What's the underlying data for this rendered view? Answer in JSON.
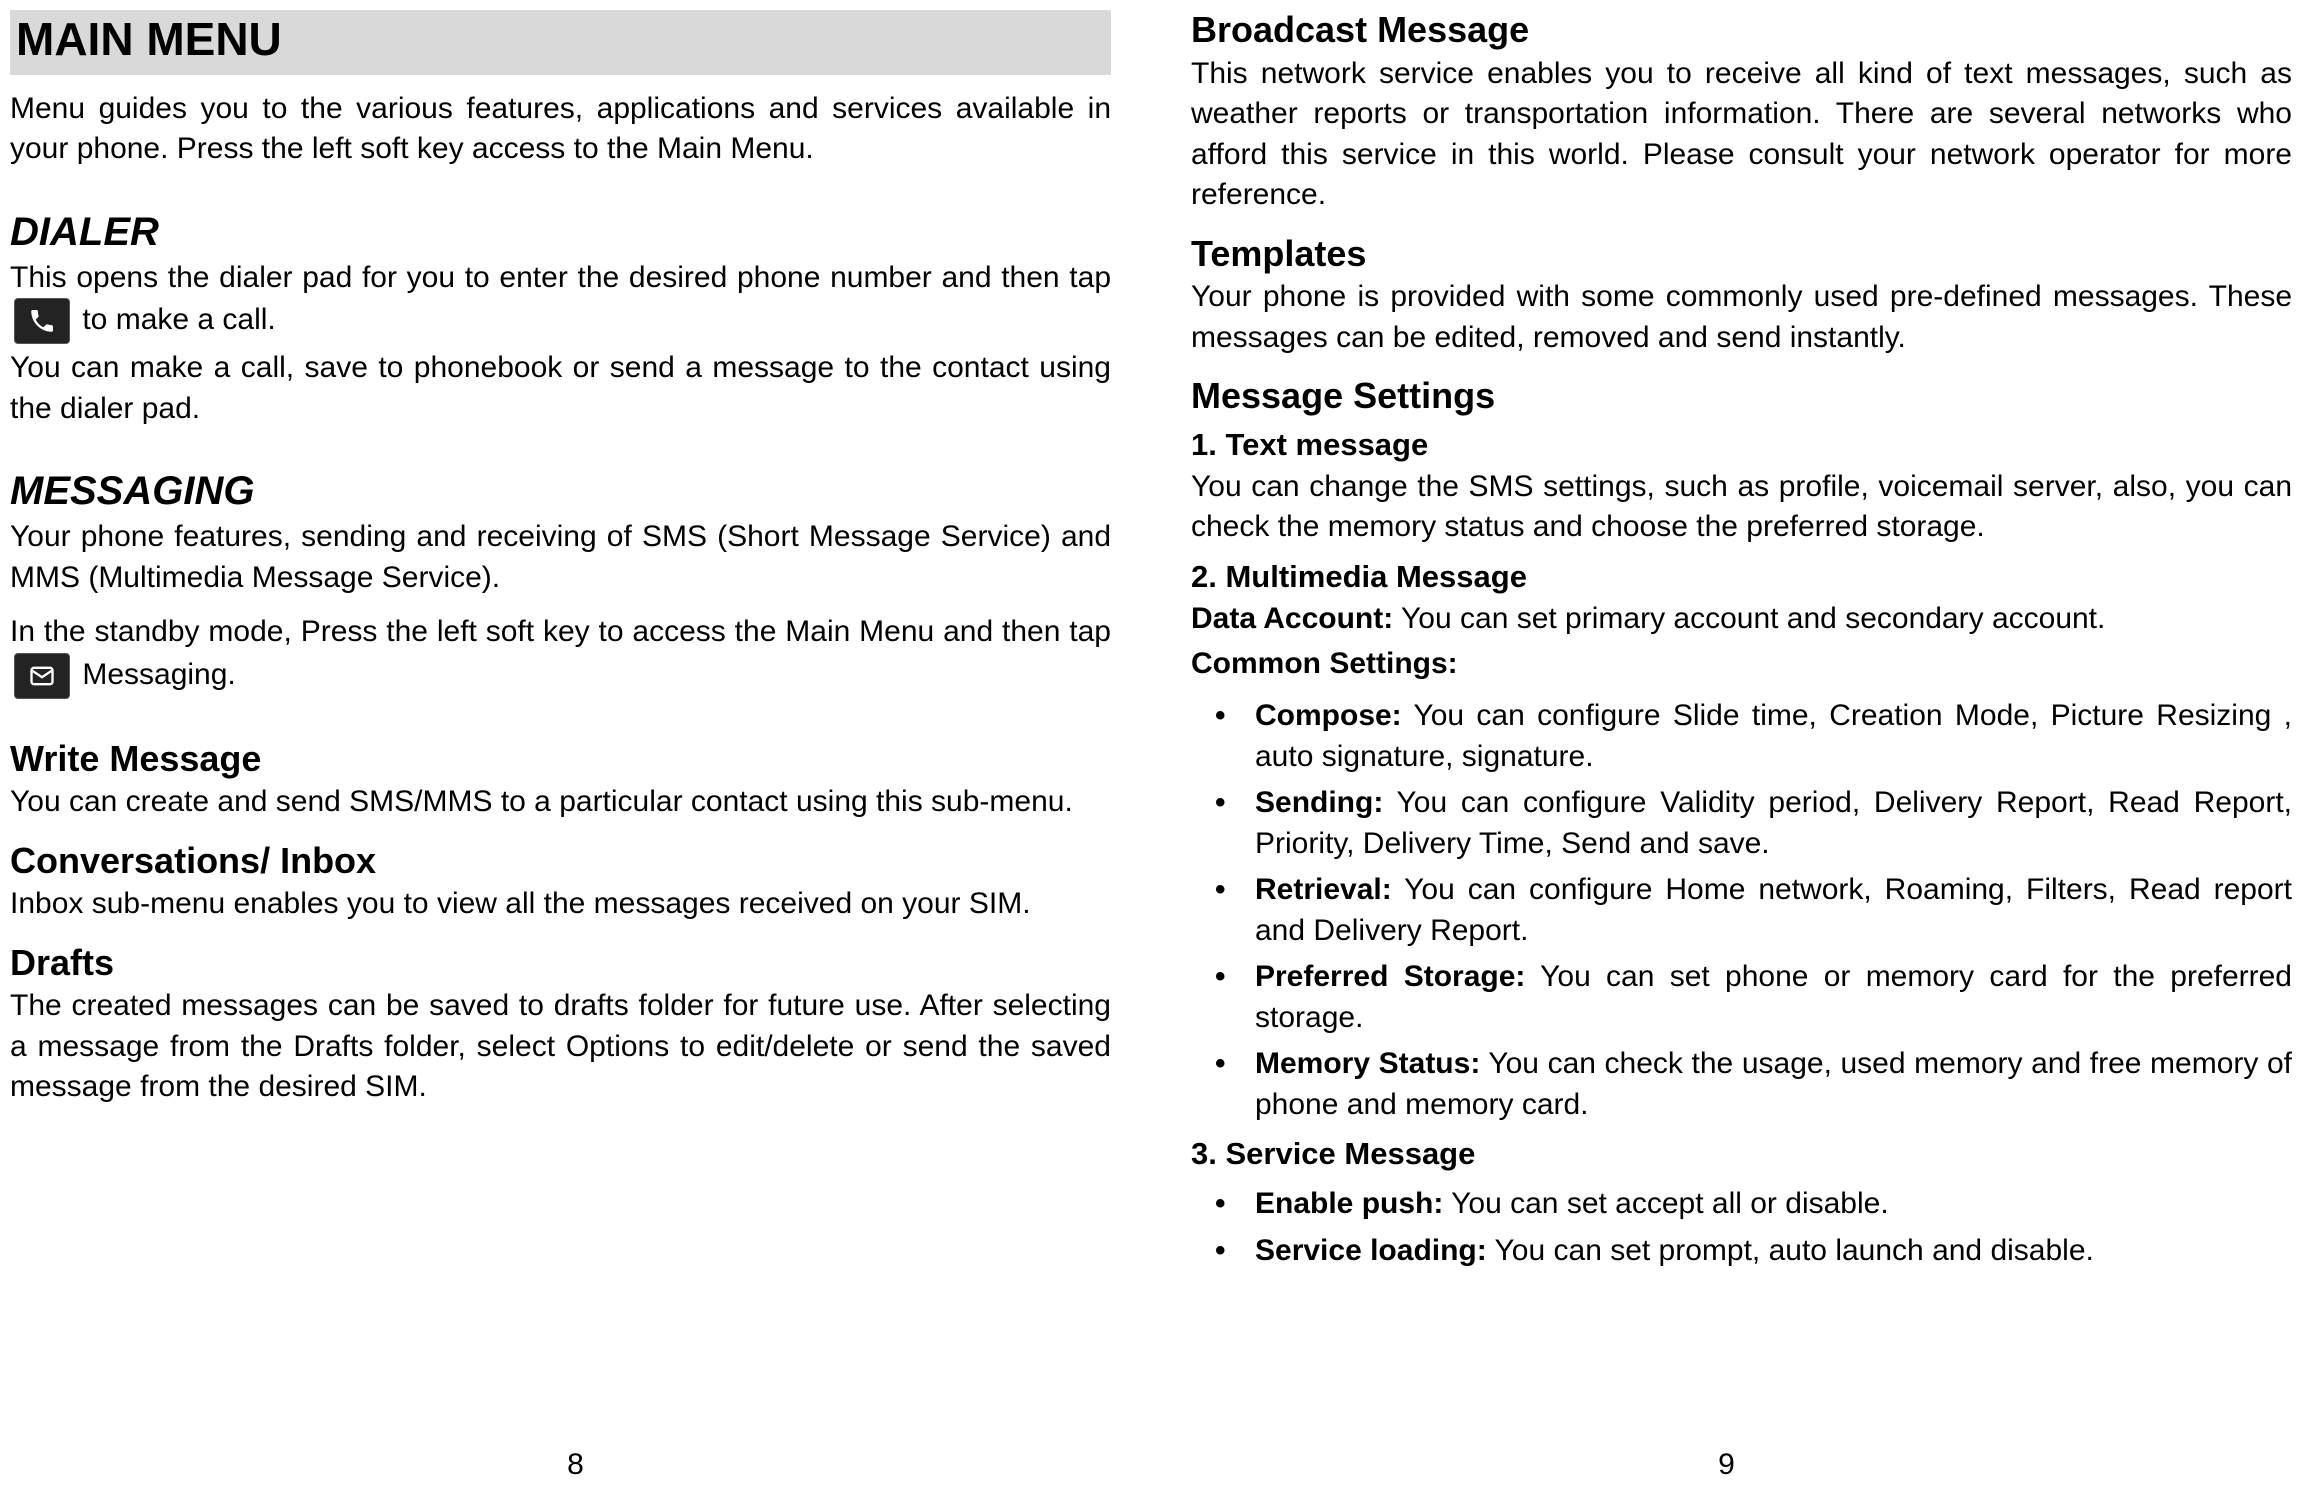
{
  "left": {
    "page_number": "8",
    "title": "MAIN MENU",
    "intro": "Menu guides you to the various features, applications and services available in your phone. Press the left soft key access to the Main Menu.",
    "dialer": {
      "heading": "DIALER",
      "p1a": "This opens the dialer pad for you to enter the desired phone number and then tap ",
      "p1b": " to make a call.",
      "p2": "You can make a call, save to phonebook or send a message to the contact using the dialer pad."
    },
    "messaging": {
      "heading": "MESSAGING",
      "p1": "Your phone features, sending and receiving of SMS (Short Message Service) and MMS (Multimedia Message Service).",
      "p2a": "In the standby mode, Press the left soft key to access the Main Menu and then tap ",
      "p2b": " Messaging."
    },
    "write": {
      "heading": "Write Message",
      "p1": "You can create and send SMS/MMS to a particular contact using this sub-menu."
    },
    "inbox": {
      "heading": "Conversations/ Inbox",
      "p1": "Inbox sub-menu enables you to view all the messages received on your SIM."
    },
    "drafts": {
      "heading": "Drafts",
      "p1": "The created messages can be saved to drafts folder for future use. After selecting a message from the Drafts folder, select Options to edit/delete or send the saved message from the desired SIM."
    }
  },
  "right": {
    "page_number": "9",
    "broadcast": {
      "heading": "Broadcast Message",
      "p1": "This network service enables you to receive all kind of text messages, such as weather reports or transportation information. There are several networks who afford this service in this world. Please consult your network operator for more reference."
    },
    "templates": {
      "heading": "Templates",
      "p1": "Your phone is provided with some commonly used pre-defined messages. These messages can be edited, removed and send instantly."
    },
    "settings": {
      "heading": "Message Settings",
      "text_msg": {
        "heading": "1. Text message",
        "p1": "You can change the SMS settings, such as profile, voicemail server, also, you can check the memory status and choose the preferred storage."
      },
      "mms": {
        "heading": "2. Multimedia Message",
        "data_account_label": "Data Account:",
        "data_account_text": " You can set primary account and secondary account.",
        "common_settings_label": "Common Settings:",
        "bullets": [
          {
            "label": "Compose:",
            "text": " You can configure Slide time, Creation Mode, Picture Resizing , auto signature, signature."
          },
          {
            "label": "Sending:",
            "text": " You can configure Validity period, Delivery Report, Read Report, Priority, Delivery Time, Send and save."
          },
          {
            "label": "Retrieval:",
            "text": " You can configure Home network, Roaming, Filters, Read report and Delivery Report."
          },
          {
            "label": "Preferred Storage:",
            "text": " You can set phone or memory card for the preferred storage."
          },
          {
            "label": "Memory Status:",
            "text": " You can check the usage, used memory and free memory of phone and memory card."
          }
        ]
      },
      "service": {
        "heading": "3. Service Message",
        "bullets": [
          {
            "label": "Enable push:",
            "text": " You can set accept all or disable."
          },
          {
            "label": "Service loading:",
            "text": " You can set prompt, auto launch and disable."
          }
        ]
      }
    }
  }
}
